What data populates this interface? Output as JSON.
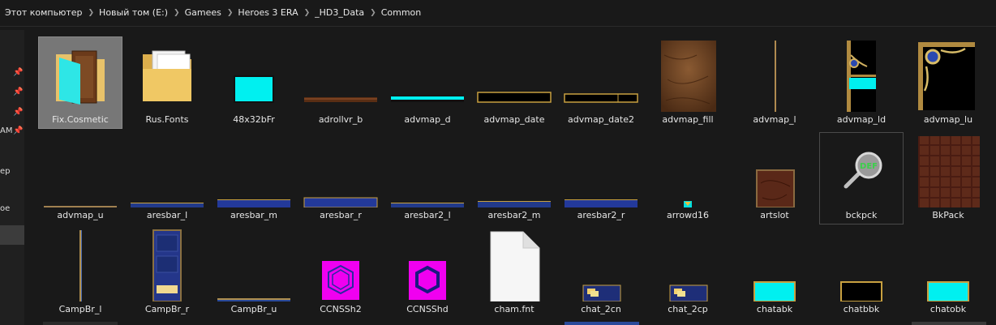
{
  "breadcrumb": [
    "Этот компьютер",
    "Новый том (E:)",
    "Gamees",
    "Heroes 3 ERA",
    "_HD3_Data",
    "Common"
  ],
  "sidebar": [
    {
      "label": "",
      "pinned": true
    },
    {
      "label": "",
      "pinned": true
    },
    {
      "label": "",
      "pinned": true
    },
    {
      "label": "AM",
      "pinned": true
    },
    {
      "label": "ер",
      "pinned": false
    },
    {
      "label": "ое",
      "pinned": false
    },
    {
      "label": "",
      "pinned": false,
      "selected": true
    }
  ],
  "items": [
    {
      "name": "Fix.Cosmetic",
      "icon": "folder-cyan-icon",
      "selected": true
    },
    {
      "name": "Rus.Fonts",
      "icon": "folder-docs-icon"
    },
    {
      "name": "48x32bFr",
      "icon": "cyan-frame-icon"
    },
    {
      "name": "adrollvr_b",
      "icon": "leather-bar-icon"
    },
    {
      "name": "advmap_d",
      "icon": "cyan-strip-icon"
    },
    {
      "name": "advmap_date",
      "icon": "black-gold-bar-icon"
    },
    {
      "name": "advmap_date2",
      "icon": "black-gold-bar2-icon"
    },
    {
      "name": "advmap_fill",
      "icon": "leather-panel-icon"
    },
    {
      "name": "advmap_l",
      "icon": "thin-vertical-line-icon"
    },
    {
      "name": "advmap_ld",
      "icon": "ornate-corner-cyan-icon"
    },
    {
      "name": "advmap_lu",
      "icon": "ornate-corner-icon"
    },
    {
      "name": "advmap_u",
      "icon": "thin-horizontal-line-icon"
    },
    {
      "name": "aresbar_l",
      "icon": "blue-bar-icon"
    },
    {
      "name": "aresbar_m",
      "icon": "blue-bar-icon"
    },
    {
      "name": "aresbar_r",
      "icon": "blue-bar-icon"
    },
    {
      "name": "aresbar2_l",
      "icon": "blue-bar-icon"
    },
    {
      "name": "aresbar2_m",
      "icon": "blue-bar-icon"
    },
    {
      "name": "aresbar2_r",
      "icon": "blue-bar-icon"
    },
    {
      "name": "arrowd16",
      "icon": "small-arrow-icon"
    },
    {
      "name": "artslot",
      "icon": "art-slot-icon"
    },
    {
      "name": "bckpck",
      "icon": "def-magnifier-icon",
      "hover": true
    },
    {
      "name": "BkPack",
      "icon": "brick-grid-icon"
    },
    {
      "name": "CampBr_l",
      "icon": "gold-vertical-line-icon"
    },
    {
      "name": "CampBr_r",
      "icon": "blue-tall-panel-icon"
    },
    {
      "name": "CampBr_u",
      "icon": "gold-horizontal-line-icon"
    },
    {
      "name": "CCNSSh2",
      "icon": "magenta-hex-icon"
    },
    {
      "name": "CCNSShd",
      "icon": "magenta-hex-bold-icon"
    },
    {
      "name": "cham.fnt",
      "icon": "blank-file-icon"
    },
    {
      "name": "chat_2cn",
      "icon": "chat-bubble-icon"
    },
    {
      "name": "chat_2cp",
      "icon": "chat-bubble-icon"
    },
    {
      "name": "chatabk",
      "icon": "cyan-box-icon"
    },
    {
      "name": "chatbbk",
      "icon": "black-box-icon"
    },
    {
      "name": "chatobk",
      "icon": "cyan-box-icon"
    }
  ],
  "colors": {
    "accent_cyan": "#00f0f0",
    "magenta": "#f000f0",
    "gold": "#c8a040",
    "selection": "#777777"
  }
}
